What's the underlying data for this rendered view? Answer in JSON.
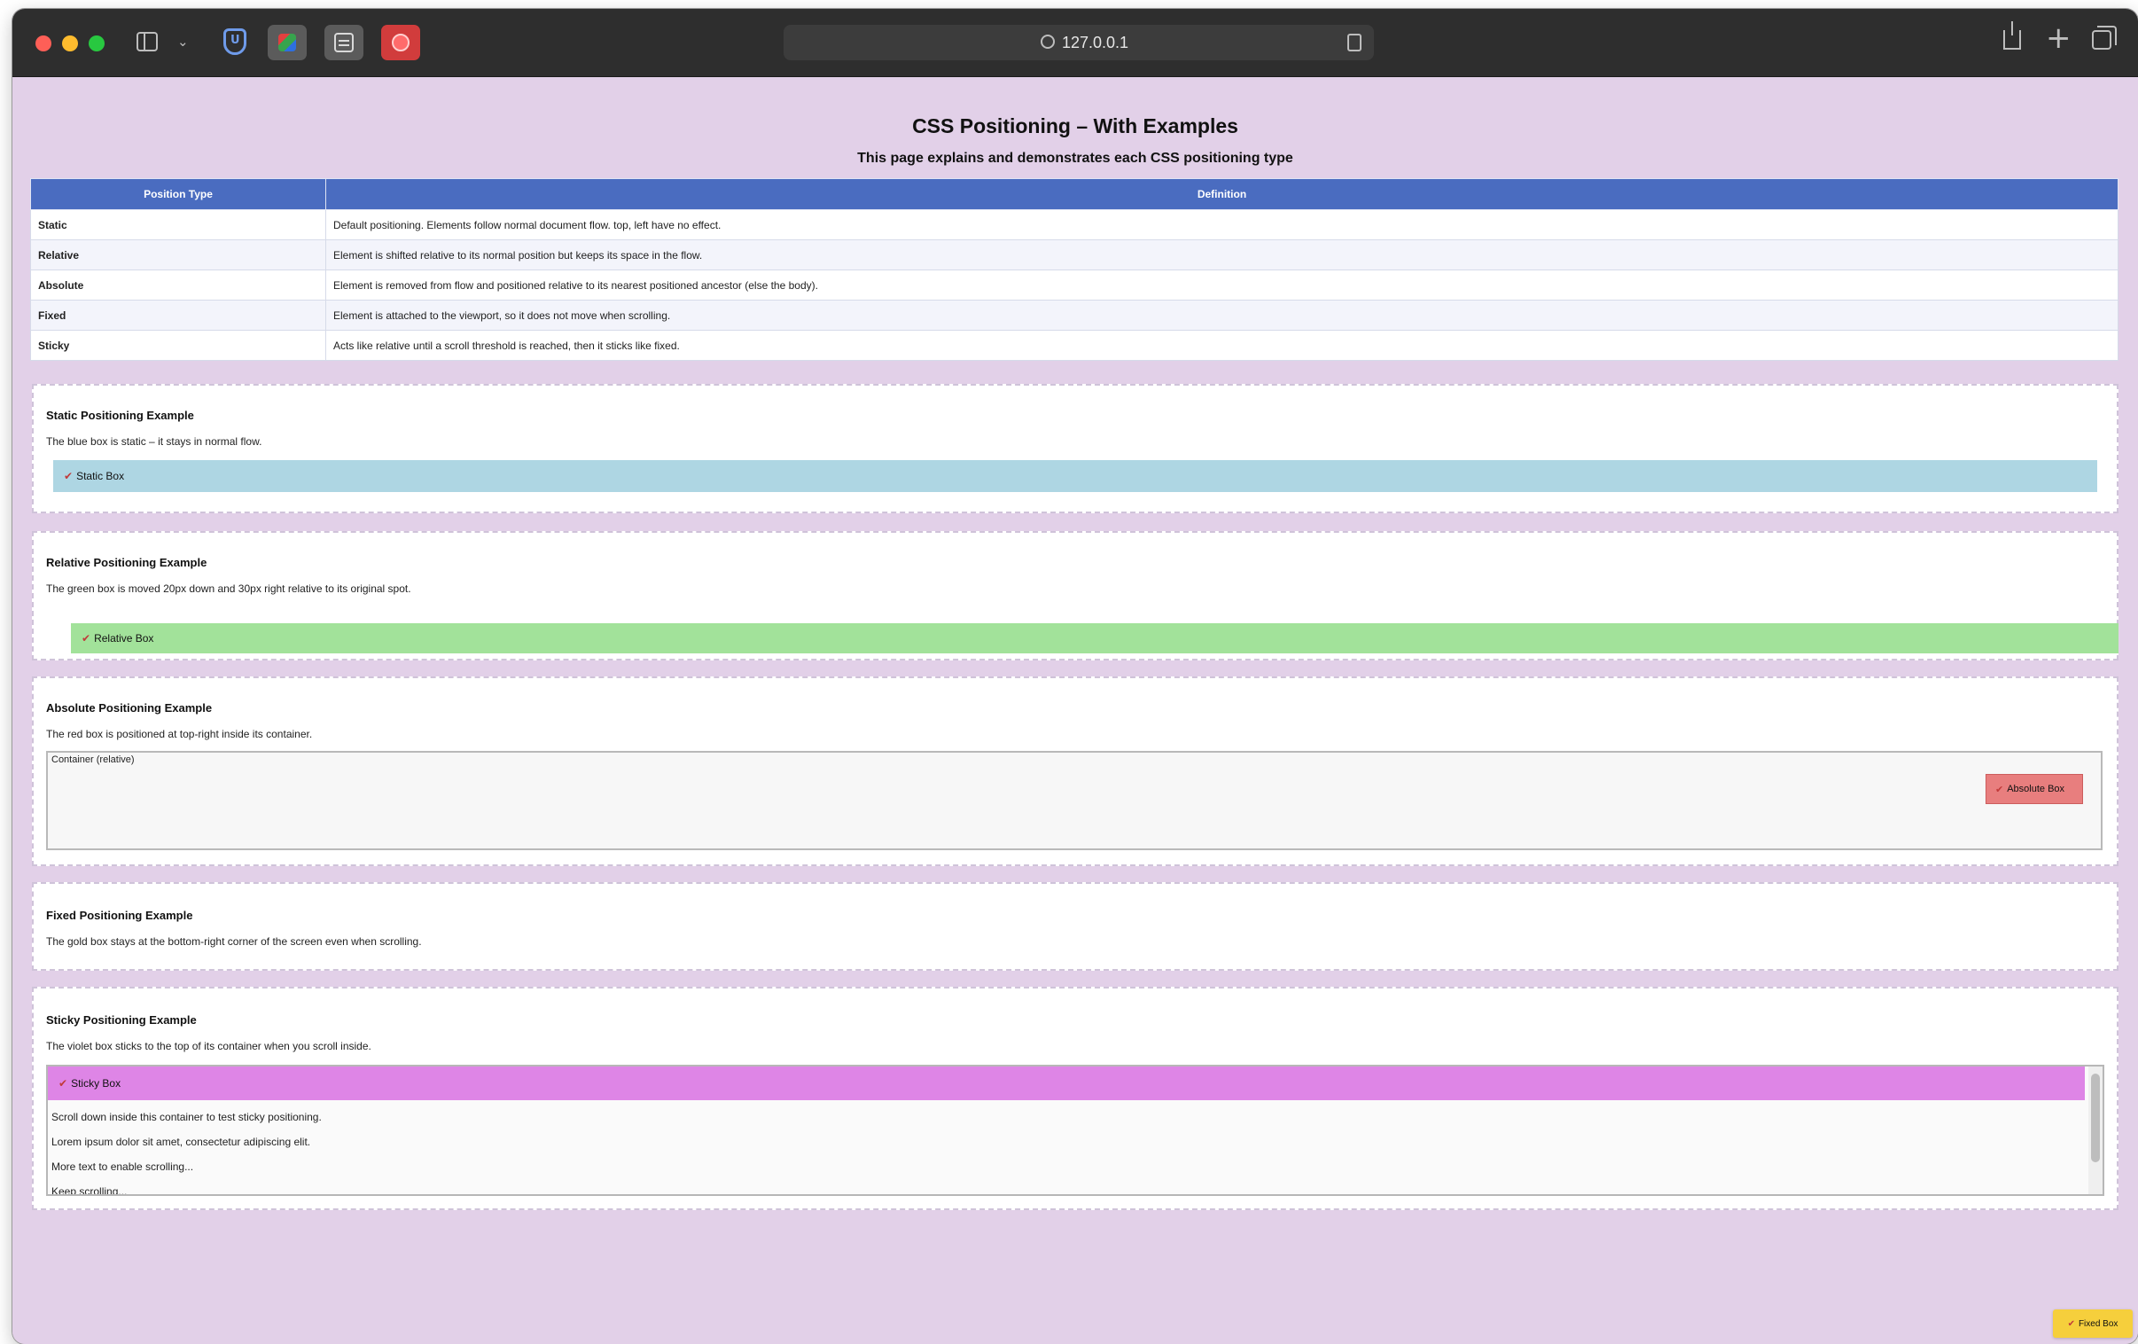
{
  "browser": {
    "url": "127.0.0.1"
  },
  "page": {
    "title": "CSS Positioning – With Examples",
    "subtitle": "This page explains and demonstrates each CSS positioning type"
  },
  "table": {
    "headers": [
      "Position Type",
      "Definition"
    ],
    "rows": [
      {
        "type": "Static",
        "definition": "Default positioning. Elements follow normal document flow. top, left have no effect."
      },
      {
        "type": "Relative",
        "definition": "Element is shifted relative to its normal position but keeps its space in the flow."
      },
      {
        "type": "Absolute",
        "definition": "Element is removed from flow and positioned relative to its nearest positioned ancestor (else the body)."
      },
      {
        "type": "Fixed",
        "definition": "Element is attached to the viewport, so it does not move when scrolling."
      },
      {
        "type": "Sticky",
        "definition": "Acts like relative until a scroll threshold is reached, then it sticks like fixed."
      }
    ]
  },
  "sections": {
    "static": {
      "title": "Static Positioning Example",
      "description": "The blue box is static – it stays in normal flow.",
      "box_label": "Static Box"
    },
    "relative": {
      "title": "Relative Positioning Example",
      "description": "The green box is moved 20px down and 30px right relative to its original spot.",
      "box_label": "Relative Box"
    },
    "absolute": {
      "title": "Absolute Positioning Example",
      "description": "The red box is positioned at top-right inside its container.",
      "container_label": "Container (relative)",
      "box_label": "Absolute Box"
    },
    "fixed": {
      "title": "Fixed Positioning Example",
      "description": "The gold box stays at the bottom-right corner of the screen even when scrolling.",
      "box_label": "Fixed Box"
    },
    "sticky": {
      "title": "Sticky Positioning Example",
      "description": "The violet box sticks to the top of its container when you scroll inside.",
      "box_label": "Sticky Box",
      "lines": [
        "Scroll down inside this container to test sticky positioning.",
        "Lorem ipsum dolor sit amet, consectetur adipiscing elit.",
        "More text to enable scrolling...",
        "Keep scrolling..."
      ]
    }
  },
  "check_glyph": "✔",
  "colors": {
    "page_bg": "#e2d0e8",
    "table_header": "#4a6cc0",
    "static_box": "#aed6e3",
    "relative_box": "#a2e29a",
    "absolute_box": "#e87e7e",
    "sticky_box": "#de85e6",
    "fixed_box": "#f6cf3c"
  }
}
